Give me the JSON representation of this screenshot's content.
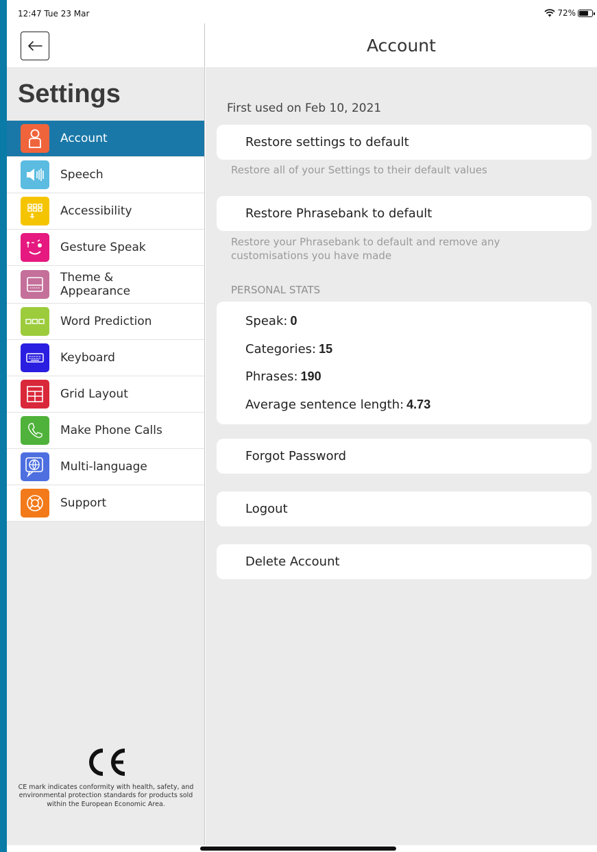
{
  "status_bar": {
    "time": "12:47  Tue 23 Mar",
    "battery": "72%",
    "battery_level": 0.72
  },
  "sidebar": {
    "title": "Settings",
    "items": [
      {
        "label": "Account",
        "icon": "person-icon",
        "color": "#f0643c",
        "active": true
      },
      {
        "label": "Speech",
        "icon": "speaker-icon",
        "color": "#5bbbe0",
        "active": false
      },
      {
        "label": "Accessibility",
        "icon": "accessibility-grid-icon",
        "color": "#f5c400",
        "active": false
      },
      {
        "label": "Gesture Speak",
        "icon": "gesture-face-icon",
        "color": "#e5197f",
        "active": false
      },
      {
        "label": "Theme &\nAppearance",
        "icon": "theme-icon",
        "color": "#c4709a",
        "active": false
      },
      {
        "label": "Word Prediction",
        "icon": "word-prediction-icon",
        "color": "#9ccc3c",
        "active": false
      },
      {
        "label": "Keyboard",
        "icon": "keyboard-icon",
        "color": "#2a1ee0",
        "active": false
      },
      {
        "label": "Grid Layout",
        "icon": "grid-icon",
        "color": "#d9283a",
        "active": false
      },
      {
        "label": "Make Phone Calls",
        "icon": "phone-icon",
        "color": "#4fb23a",
        "active": false
      },
      {
        "label": "Multi-language",
        "icon": "globe-icon",
        "color": "#4d6fe0",
        "active": false
      },
      {
        "label": "Support",
        "icon": "lifebuoy-icon",
        "color": "#f27a1a",
        "active": false
      }
    ],
    "ce_text": "CE mark indicates conformity with health, safety, and environmental protection standards for products sold within the European Economic Area."
  },
  "main": {
    "title": "Account",
    "first_used": "First used on Feb 10, 2021",
    "restore_settings_label": "Restore settings to default",
    "restore_settings_help": "Restore all of your Settings to their default values",
    "restore_phrasebank_label": "Restore Phrasebank to default",
    "restore_phrasebank_help": "Restore your Phrasebank to default and remove any customisations you have made",
    "stats_heading": "PERSONAL STATS",
    "stats": [
      {
        "label": "Speak:",
        "value": "0"
      },
      {
        "label": "Categories:",
        "value": "15"
      },
      {
        "label": "Phrases:",
        "value": "190"
      },
      {
        "label": "Average sentence length:",
        "value": "4.73"
      }
    ],
    "forgot_password_label": "Forgot Password",
    "logout_label": "Logout",
    "delete_account_label": "Delete Account"
  }
}
